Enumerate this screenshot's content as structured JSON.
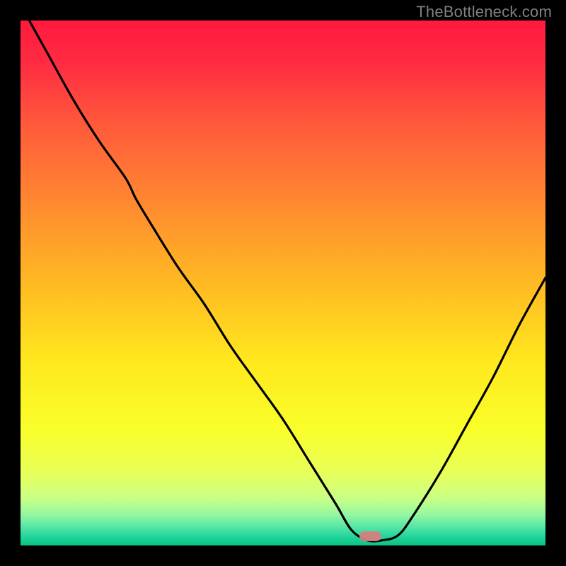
{
  "credit": "TheBottleneck.com",
  "colors": {
    "black": "#000000",
    "marker": "rgba(214,128,128,0.95)",
    "curve": "#000000"
  },
  "marker_box": {
    "x_pct": 64.5,
    "y_pct": 98.2,
    "w_pct": 4.2,
    "h_pct": 1.9
  },
  "chart_data": {
    "type": "line",
    "title": "",
    "xlabel": "",
    "ylabel": "",
    "xlim": [
      0,
      100
    ],
    "ylim": [
      0,
      100
    ],
    "grid": false,
    "legend": null,
    "series": [
      {
        "name": "bottleneck-curve",
        "x": [
          0,
          5,
          10,
          15,
          20,
          22,
          25,
          30,
          35,
          40,
          45,
          50,
          55,
          60,
          63,
          66,
          69,
          72,
          75,
          80,
          85,
          90,
          95,
          100
        ],
        "y": [
          103,
          94,
          85,
          77,
          70,
          66,
          61,
          53,
          46,
          38,
          31,
          24,
          16,
          8,
          3,
          1,
          1,
          2,
          6,
          14,
          23,
          32,
          42,
          51
        ],
        "note": "y is plotted with origin at bottom; minimum (optimal) near x≈66"
      }
    ],
    "gradient_stops": [
      {
        "offset": 0.0,
        "color": "#ff1a3e"
      },
      {
        "offset": 0.08,
        "color": "#ff2b42"
      },
      {
        "offset": 0.2,
        "color": "#ff5a3b"
      },
      {
        "offset": 0.35,
        "color": "#ff8a30"
      },
      {
        "offset": 0.5,
        "color": "#ffb923"
      },
      {
        "offset": 0.65,
        "color": "#ffe81e"
      },
      {
        "offset": 0.78,
        "color": "#f9ff2a"
      },
      {
        "offset": 0.86,
        "color": "#e9ff58"
      },
      {
        "offset": 0.91,
        "color": "#c9ff85"
      },
      {
        "offset": 0.94,
        "color": "#97f8a0"
      },
      {
        "offset": 0.965,
        "color": "#55e6a6"
      },
      {
        "offset": 0.985,
        "color": "#1dd39a"
      },
      {
        "offset": 1.0,
        "color": "#0fc183"
      }
    ],
    "marker": {
      "x": 66.5,
      "y": 0.5,
      "label": ""
    }
  }
}
